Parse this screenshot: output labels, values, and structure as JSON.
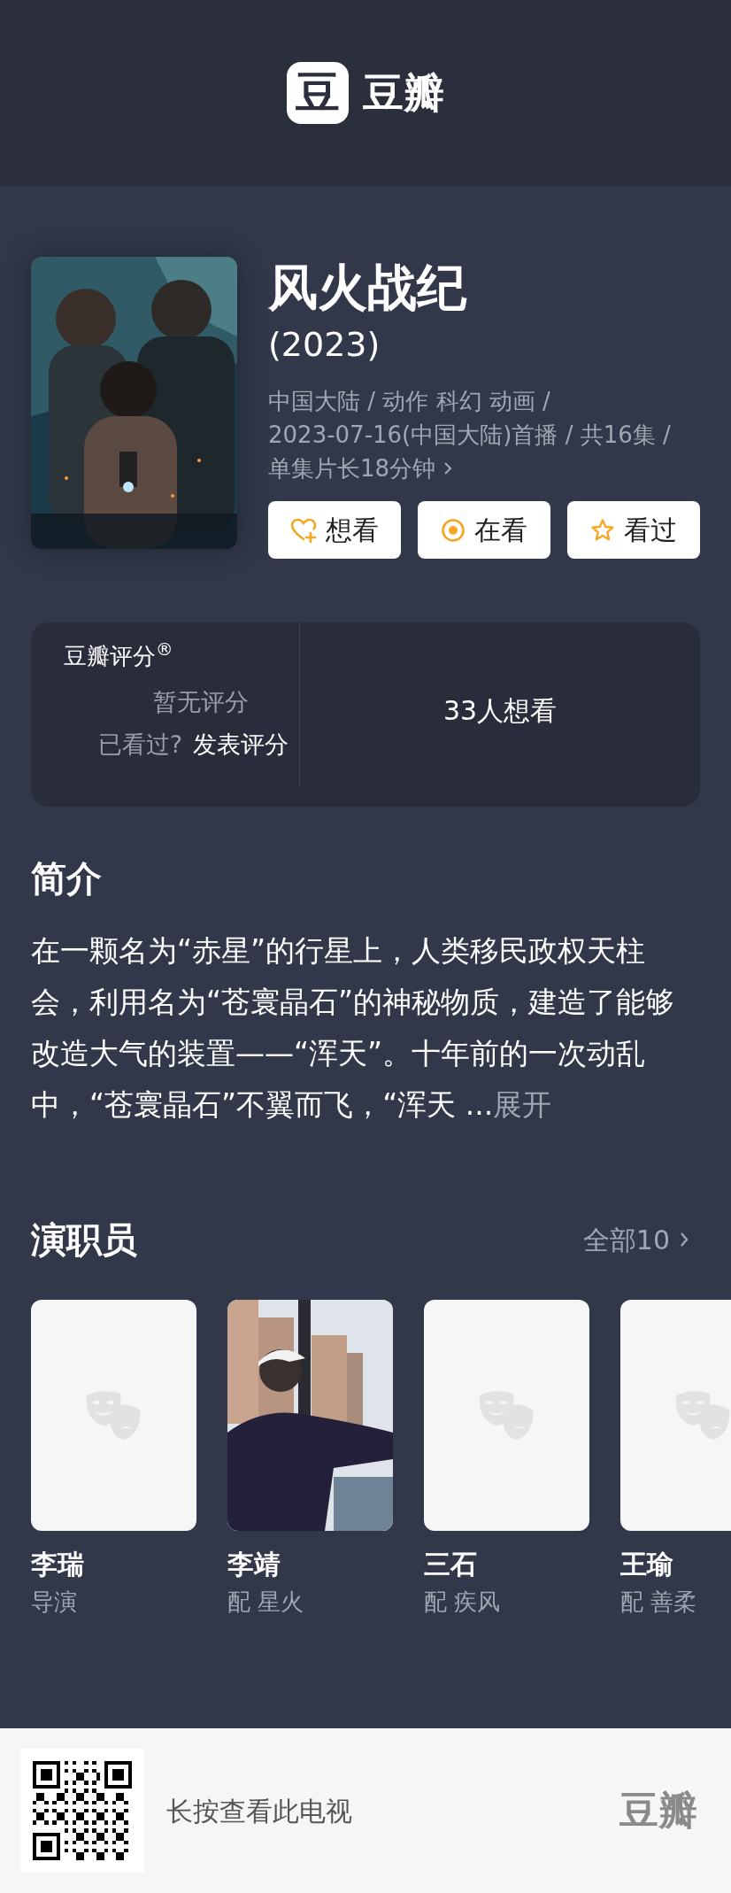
{
  "header": {
    "logo_mark": "豆",
    "logo_text": "豆瓣"
  },
  "title": "风火战纪",
  "year": "(2023)",
  "meta_lines": [
    "中国大陆 / 动作 科幻 动画 /",
    "2023-07-16(中国大陆)首播 / 共16集 /",
    "单集片长18分钟"
  ],
  "actions": [
    {
      "label": "想看",
      "kind": "wish"
    },
    {
      "label": "在看",
      "kind": "watching"
    },
    {
      "label": "看过",
      "kind": "watched"
    }
  ],
  "rating": {
    "title": "豆瓣评分$^{®}$",
    "status": "暂无评分",
    "prompt": "已看过?",
    "action": "发表评分",
    "wish_count": "33人想看"
  },
  "intro": {
    "heading": "简介",
    "text": "在一颗名为“赤星”的行星上，人类移民政权天柱会，利用名为“苍寰晶石”的神秘物质，建造了能够改造大气的装置——“浑天”。十年前的一次动乱中，“苍寰晶石”不翼而飞，“浑天 ...",
    "expand": "展开"
  },
  "cast": {
    "heading": "演职员",
    "all": "全部10",
    "members": [
      {
        "name": "李瑞",
        "role": "导演",
        "kind": "placeholder"
      },
      {
        "name": "李靖",
        "role": "配 星火"
      },
      {
        "name": "三石",
        "role": "配 疾风",
        "kind": "placeholder"
      },
      {
        "name": "王瑜",
        "role": "配 善柔",
        "kind": "placeholder"
      }
    ]
  },
  "footer": {
    "hint": "长按查看此电视",
    "logo": "豆瓣"
  }
}
